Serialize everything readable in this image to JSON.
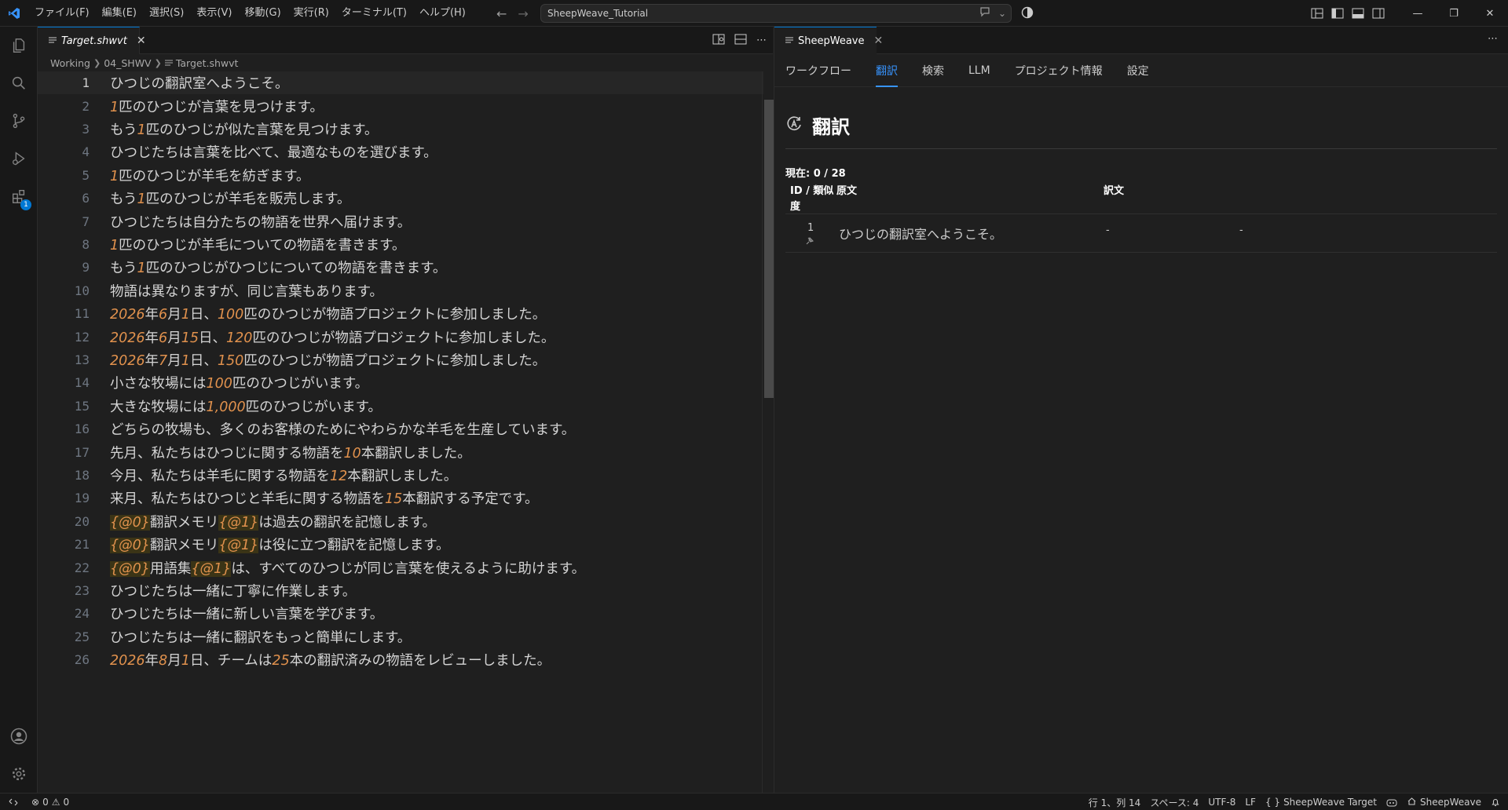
{
  "titlebar": {
    "menus": [
      "ファイル(F)",
      "編集(E)",
      "選択(S)",
      "表示(V)",
      "移動(G)",
      "実行(R)",
      "ターミナル(T)",
      "ヘルプ(H)"
    ],
    "search_text": "SheepWeave_Tutorial"
  },
  "activity_bar": {
    "extensions_badge": "1"
  },
  "editor": {
    "tab_label": "Target.shwvt",
    "breadcrumb": [
      "Working",
      "04_SHWV",
      "Target.shwvt"
    ],
    "lines": [
      {
        "n": "1",
        "segs": [
          {
            "t": "ひつじの翻訳室へようこそ。"
          }
        ]
      },
      {
        "n": "2",
        "segs": [
          {
            "t": "1",
            "k": "num"
          },
          {
            "t": "匹のひつじが言葉を見つけます。"
          }
        ]
      },
      {
        "n": "3",
        "segs": [
          {
            "t": "もう"
          },
          {
            "t": "1",
            "k": "num"
          },
          {
            "t": "匹のひつじが似た言葉を見つけます。"
          }
        ]
      },
      {
        "n": "4",
        "segs": [
          {
            "t": "ひつじたちは言葉を比べて、最適なものを選びます。"
          }
        ]
      },
      {
        "n": "5",
        "segs": [
          {
            "t": "1",
            "k": "num"
          },
          {
            "t": "匹のひつじが羊毛を紡ぎます。"
          }
        ]
      },
      {
        "n": "6",
        "segs": [
          {
            "t": "もう"
          },
          {
            "t": "1",
            "k": "num"
          },
          {
            "t": "匹のひつじが羊毛を販売します。"
          }
        ]
      },
      {
        "n": "7",
        "segs": [
          {
            "t": "ひつじたちは自分たちの物語を世界へ届けます。"
          }
        ]
      },
      {
        "n": "8",
        "segs": [
          {
            "t": "1",
            "k": "num"
          },
          {
            "t": "匹のひつじが羊毛についての物語を書きます。"
          }
        ]
      },
      {
        "n": "9",
        "segs": [
          {
            "t": "もう"
          },
          {
            "t": "1",
            "k": "num"
          },
          {
            "t": "匹のひつじがひつじについての物語を書きます。"
          }
        ]
      },
      {
        "n": "10",
        "segs": [
          {
            "t": "物語は異なりますが、同じ言葉もあります。"
          }
        ]
      },
      {
        "n": "11",
        "segs": [
          {
            "t": "2026",
            "k": "num"
          },
          {
            "t": "年"
          },
          {
            "t": "6",
            "k": "num"
          },
          {
            "t": "月"
          },
          {
            "t": "1",
            "k": "num"
          },
          {
            "t": "日、"
          },
          {
            "t": "100",
            "k": "num"
          },
          {
            "t": "匹のひつじが物語プロジェクトに参加しました。"
          }
        ]
      },
      {
        "n": "12",
        "segs": [
          {
            "t": "2026",
            "k": "num"
          },
          {
            "t": "年"
          },
          {
            "t": "6",
            "k": "num"
          },
          {
            "t": "月"
          },
          {
            "t": "15",
            "k": "num"
          },
          {
            "t": "日、"
          },
          {
            "t": "120",
            "k": "num"
          },
          {
            "t": "匹のひつじが物語プロジェクトに参加しました。"
          }
        ]
      },
      {
        "n": "13",
        "segs": [
          {
            "t": "2026",
            "k": "num"
          },
          {
            "t": "年"
          },
          {
            "t": "7",
            "k": "num"
          },
          {
            "t": "月"
          },
          {
            "t": "1",
            "k": "num"
          },
          {
            "t": "日、"
          },
          {
            "t": "150",
            "k": "num"
          },
          {
            "t": "匹のひつじが物語プロジェクトに参加しました。"
          }
        ]
      },
      {
        "n": "14",
        "segs": [
          {
            "t": "小さな牧場には"
          },
          {
            "t": "100",
            "k": "num"
          },
          {
            "t": "匹のひつじがいます。"
          }
        ]
      },
      {
        "n": "15",
        "segs": [
          {
            "t": "大きな牧場には"
          },
          {
            "t": "1,000",
            "k": "num"
          },
          {
            "t": "匹のひつじがいます。"
          }
        ]
      },
      {
        "n": "16",
        "segs": [
          {
            "t": "どちらの牧場も、多くのお客様のためにやわらかな羊毛を生産しています。"
          }
        ]
      },
      {
        "n": "17",
        "segs": [
          {
            "t": "先月、私たちはひつじに関する物語を"
          },
          {
            "t": "10",
            "k": "num"
          },
          {
            "t": "本翻訳しました。"
          }
        ]
      },
      {
        "n": "18",
        "segs": [
          {
            "t": "今月、私たちは羊毛に関する物語を"
          },
          {
            "t": "12",
            "k": "num"
          },
          {
            "t": "本翻訳しました。"
          }
        ]
      },
      {
        "n": "19",
        "segs": [
          {
            "t": "来月、私たちはひつじと羊毛に関する物語を"
          },
          {
            "t": "15",
            "k": "num"
          },
          {
            "t": "本翻訳する予定です。"
          }
        ]
      },
      {
        "n": "20",
        "segs": [
          {
            "t": "{@0}",
            "k": "ph"
          },
          {
            "t": "翻訳メモリ"
          },
          {
            "t": "{@1}",
            "k": "ph"
          },
          {
            "t": "は過去の翻訳を記憶します。"
          }
        ]
      },
      {
        "n": "21",
        "segs": [
          {
            "t": "{@0}",
            "k": "ph"
          },
          {
            "t": "翻訳メモリ"
          },
          {
            "t": "{@1}",
            "k": "ph"
          },
          {
            "t": "は役に立つ翻訳を記憶します。"
          }
        ]
      },
      {
        "n": "22",
        "segs": [
          {
            "t": "{@0}",
            "k": "ph"
          },
          {
            "t": "用語集"
          },
          {
            "t": "{@1}",
            "k": "ph"
          },
          {
            "t": "は、すべてのひつじが同じ言葉を使えるように助けます。"
          }
        ]
      },
      {
        "n": "23",
        "segs": [
          {
            "t": "ひつじたちは一緒に丁寧に作業します。"
          }
        ]
      },
      {
        "n": "24",
        "segs": [
          {
            "t": "ひつじたちは一緒に新しい言葉を学びます。"
          }
        ]
      },
      {
        "n": "25",
        "segs": [
          {
            "t": "ひつじたちは一緒に翻訳をもっと簡単にします。"
          }
        ]
      },
      {
        "n": "26",
        "segs": [
          {
            "t": "2026",
            "k": "num"
          },
          {
            "t": "年"
          },
          {
            "t": "8",
            "k": "num"
          },
          {
            "t": "月"
          },
          {
            "t": "1",
            "k": "num"
          },
          {
            "t": "日、チームは"
          },
          {
            "t": "25",
            "k": "num"
          },
          {
            "t": "本の翻訳済みの物語をレビューしました。"
          }
        ]
      }
    ]
  },
  "panel": {
    "tab_label": "SheepWeave",
    "nav_tabs": [
      "ワークフロー",
      "翻訳",
      "検索",
      "LLM",
      "プロジェクト情報",
      "設定"
    ],
    "active_tab_index": 1,
    "title": "翻訳",
    "current_label": "現在: 0 / 28",
    "table": {
      "headers": {
        "id": "ID / 類似",
        "id_line2": "度",
        "source": "原文",
        "target": "訳文"
      },
      "rows": [
        {
          "id": "1",
          "source": "ひつじの翻訳室へようこそ。",
          "target": "-",
          "extra": "-"
        }
      ]
    }
  },
  "statusbar": {
    "errors": "0",
    "warnings": "0",
    "position": "行 1、列 14",
    "spaces": "スペース: 4",
    "encoding": "UTF-8",
    "eol": "LF",
    "language": "SheepWeave Target",
    "extension": "SheepWeave"
  }
}
